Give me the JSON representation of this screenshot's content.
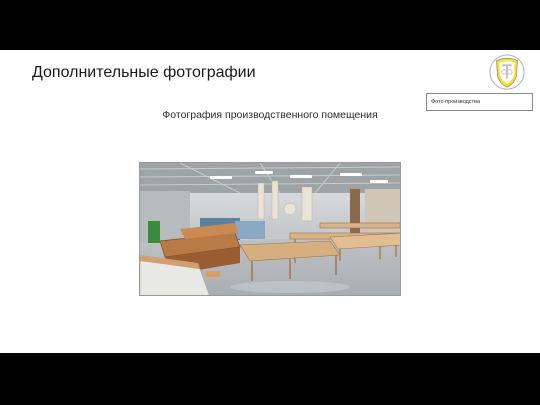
{
  "slide": {
    "title": "Дополнительные фотографии",
    "caption": "Фотография производственного помещения",
    "tag": "Фото производства"
  },
  "logo": {
    "icon": "shield-crest-icon",
    "accent": "#ffdd2d"
  },
  "photo": {
    "subject": "production-workshop-photo"
  },
  "colors": {
    "rule": "#ffdd2d",
    "frame": "#000000",
    "background": "#ffffff"
  }
}
